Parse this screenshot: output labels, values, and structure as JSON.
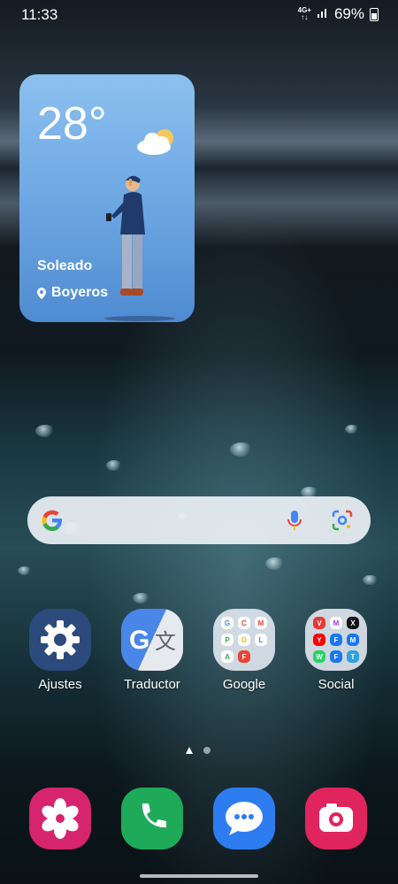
{
  "status_bar": {
    "time": "11:33",
    "network": "4G+",
    "battery": "69%"
  },
  "weather_widget": {
    "temperature": "28°",
    "condition": "Soleado",
    "location": "Boyeros"
  },
  "search_bar": {
    "logo": "G"
  },
  "apps": [
    {
      "label": "Ajustes",
      "icon": "gear-icon"
    },
    {
      "label": "Traductor",
      "icon": "translate-icon"
    },
    {
      "label": "Google",
      "icon": "folder-icon"
    },
    {
      "label": "Social",
      "icon": "folder-icon"
    }
  ],
  "google_folder": [
    "G",
    "C",
    "M",
    "P",
    "D",
    "L",
    "A",
    "F",
    "S"
  ],
  "social_folder": [
    "V",
    "M",
    "X",
    "Y",
    "F",
    "M",
    "W",
    "F",
    "T"
  ],
  "dock": [
    {
      "name": "gallery-icon"
    },
    {
      "name": "phone-icon"
    },
    {
      "name": "messages-icon"
    },
    {
      "name": "camera-icon"
    }
  ],
  "colors": {
    "weather_top": "#8cc0ef",
    "weather_bottom": "#4f8bd0",
    "gallery": "#d6246e",
    "phone": "#1faa5a",
    "messages": "#2d7df0",
    "camera": "#e0245e"
  }
}
